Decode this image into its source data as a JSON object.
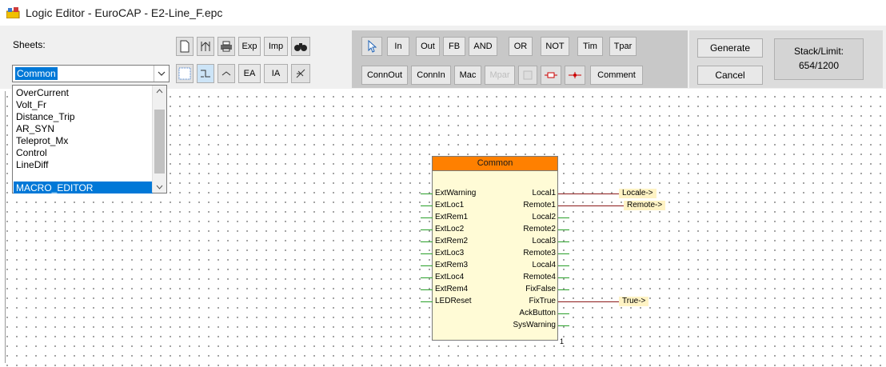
{
  "window": {
    "title": "Logic Editor - EuroCAP - E2-Line_F.epc"
  },
  "toolbar": {
    "sheets_label": "Sheets:",
    "selected_sheet": "Common",
    "buttons_row1": [
      "Exp",
      "Imp"
    ],
    "buttons_row2": [
      "EA",
      "IA"
    ],
    "group1_row1": [
      "In",
      "Out",
      "FB",
      "AND",
      "OR",
      "NOT",
      "Tim",
      "Tpar"
    ],
    "group1_row2": [
      "ConnOut",
      "ConnIn",
      "Mac",
      "Mpar",
      "Comment"
    ],
    "generate_label": "Generate",
    "cancel_label": "Cancel",
    "stack_label": "Stack/Limit:",
    "stack_value": "654/1200"
  },
  "dropdown": {
    "items": [
      "OverCurrent",
      "Volt_Fr",
      "Distance_Trip",
      "AR_SYN",
      "Teleprot_Mx",
      "Control",
      "LineDiff",
      "MACRO_EDITOR"
    ],
    "selected_index": 7
  },
  "function_block": {
    "title": "Common",
    "inputs": [
      "ExtWarning",
      "ExtLoc1",
      "ExtRem1",
      "ExtLoc2",
      "ExtRem2",
      "ExtLoc3",
      "ExtRem3",
      "ExtLoc4",
      "ExtRem4",
      "LEDReset"
    ],
    "outputs": [
      "Local1",
      "Remote1",
      "Local2",
      "Remote2",
      "Local3",
      "Remote3",
      "Local4",
      "Remote4",
      "FixFalse",
      "FixTrue",
      "AckButton",
      "SysWarning"
    ],
    "index": "1"
  },
  "connectors": {
    "local": "Locale->",
    "remote": "Remote->",
    "true": "True->"
  },
  "colors": {
    "block_header": "#ff8000",
    "block_body": "#fffbd6",
    "wire_green": "#2aa02a",
    "wire_red": "#8b1a1a",
    "selection": "#0078d7"
  }
}
